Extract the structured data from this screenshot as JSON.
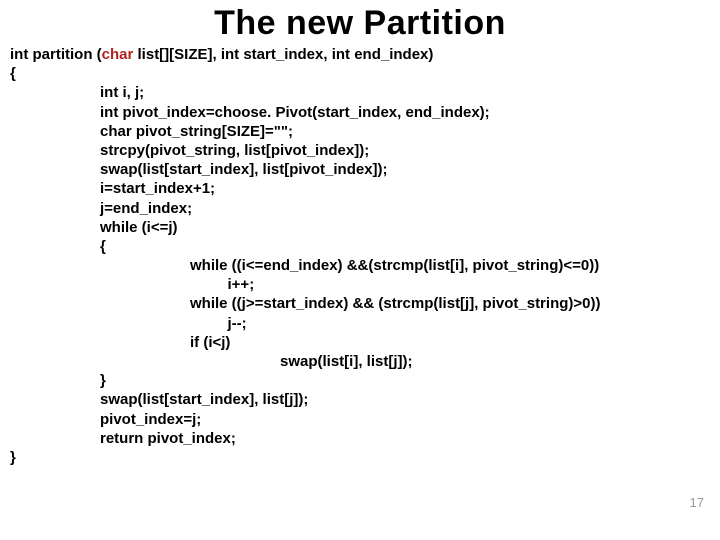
{
  "title": "The new Partition",
  "signature": {
    "kw_int1": "int",
    "fn": " partition (",
    "kw_char": "char",
    "params_rest": " list[][SIZE], ",
    "kw_int2": "int",
    "p2": " start_index, ",
    "kw_int3": "int",
    "p3": " end_index)"
  },
  "brace_open": "{",
  "body": [
    "int i, j;",
    "int pivot_index=choose. Pivot(start_index, end_index);",
    "char pivot_string[SIZE]=\"\";",
    "strcpy(pivot_string, list[pivot_index]);",
    "swap(list[start_index], list[pivot_index]);",
    "i=start_index+1;",
    "j=end_index;",
    "while (i<=j)",
    "{"
  ],
  "inner": [
    "while ((i<=end_index) &&(strcmp(list[i], pivot_string)<=0))",
    "         i++;",
    "while ((j>=start_index) && (strcmp(list[j], pivot_string)>0))",
    "         j--;",
    "if (i<j)"
  ],
  "swap_inner": "swap(list[i], list[j]);",
  "after": [
    "}",
    "swap(list[start_index], list[j]);",
    "pivot_index=j;",
    "return pivot_index;"
  ],
  "brace_close": "}",
  "page_number": "17"
}
